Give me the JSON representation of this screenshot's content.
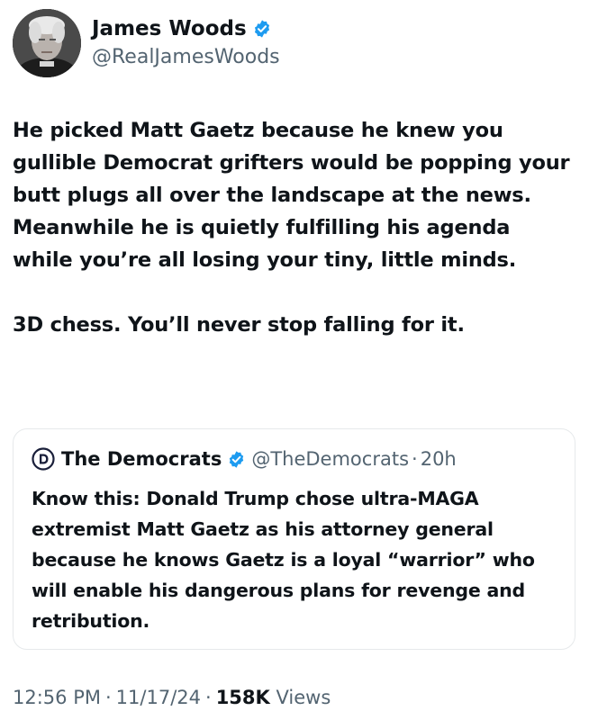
{
  "author": {
    "display_name": "James Woods",
    "handle": "@RealJamesWoods",
    "avatar_icon": "person-photo-icon",
    "verified_icon": "verified-badge-icon"
  },
  "tweet": {
    "paragraph_1": "He picked Matt Gaetz because he knew you gullible Democrat grifters would be popping your butt plugs all over the landscape at the news. Meanwhile he is quietly fulfilling his agenda while you’re all losing your tiny, little minds.",
    "paragraph_2": "3D chess. You’ll never stop falling for it."
  },
  "quote": {
    "avatar_icon": "democrats-logo-icon",
    "display_name": "The Democrats",
    "handle": "@TheDemocrats",
    "separator": "·",
    "time": "20h",
    "text": "Know this: Donald Trump chose ultra-MAGA extremist Matt Gaetz as his attorney general because he knows Gaetz is a loyal “warrior” who will enable his dangerous plans for revenge and retribution."
  },
  "meta": {
    "time": "12:56 PM",
    "separator": "·",
    "date": "11/17/24",
    "views_count": "158K",
    "views_label": "Views"
  },
  "colors": {
    "text_primary": "#0f1419",
    "text_secondary": "#536471",
    "verified_blue": "#1d9bf0",
    "border": "#e6e9eb"
  }
}
